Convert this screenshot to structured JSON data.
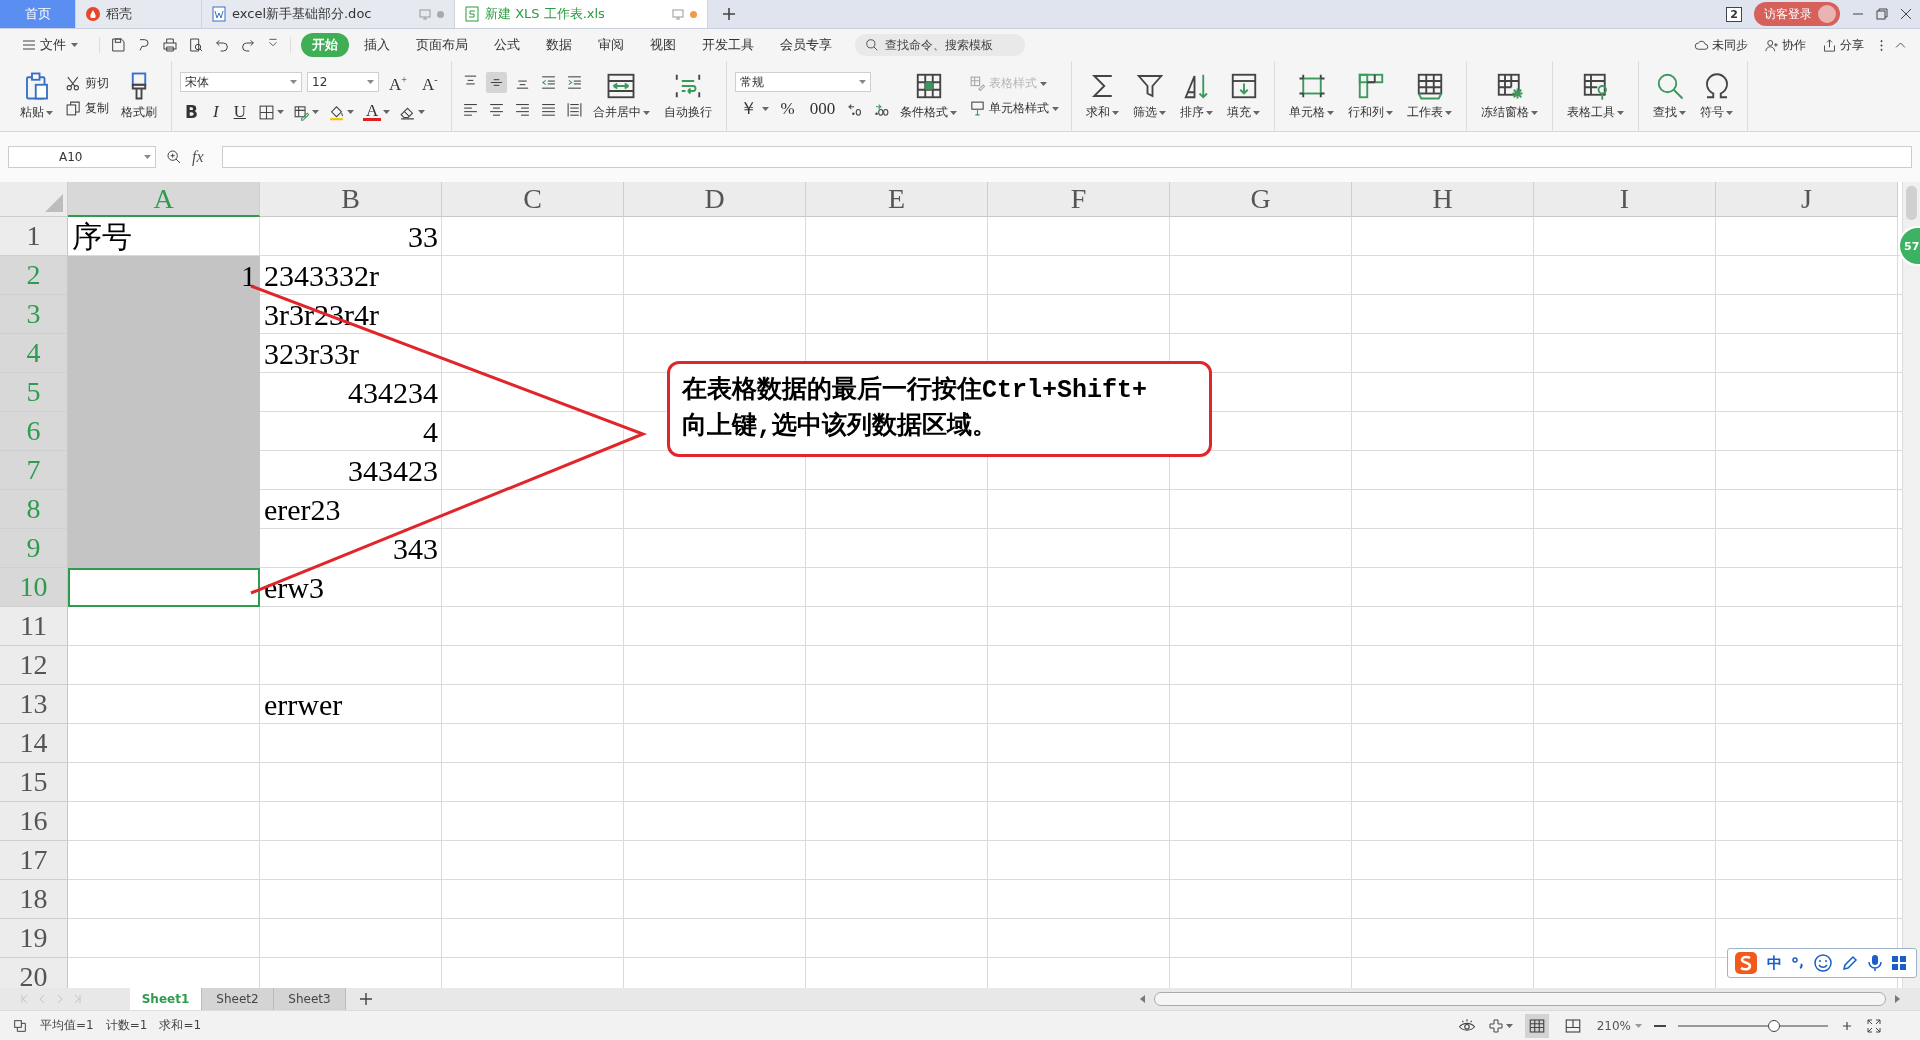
{
  "tabs": [
    {
      "kind": "home",
      "label": "首页",
      "selected": false
    },
    {
      "kind": "docer",
      "label": "稻壳",
      "selected": false
    },
    {
      "kind": "doc",
      "label": "excel新手基础部分.doc",
      "selected": false
    },
    {
      "kind": "xls",
      "label": "新建 XLS 工作表.xls",
      "selected": true
    }
  ],
  "account": {
    "windows": "2",
    "login": "访客登录"
  },
  "menu": {
    "file": "文件",
    "items": [
      {
        "label": "开始",
        "selected": true
      },
      {
        "label": "插入",
        "selected": false
      },
      {
        "label": "页面布局",
        "selected": false
      },
      {
        "label": "公式",
        "selected": false
      },
      {
        "label": "数据",
        "selected": false
      },
      {
        "label": "审阅",
        "selected": false
      },
      {
        "label": "视图",
        "selected": false
      },
      {
        "label": "开发工具",
        "selected": false
      },
      {
        "label": "会员专享",
        "selected": false
      }
    ],
    "search": {
      "placeholder": "查找命令、搜索模板"
    },
    "actions": [
      "未同步",
      "协作",
      "分享"
    ]
  },
  "ribbon": {
    "groups": [
      {
        "items": [
          {
            "kind": "large",
            "label": "粘贴",
            "dropdown": true
          },
          {
            "kind": "stack",
            "items": [
              {
                "kind": "small",
                "label": "剪切",
                "disabled": false,
                "dropdown": false
              },
              {
                "kind": "small",
                "label": "复制",
                "disabled": false,
                "dropdown": false
              }
            ]
          },
          {
            "kind": "large",
            "label": "格式刷",
            "dropdown": false
          }
        ]
      },
      {
        "items": [
          {
            "kind": "rows",
            "rows": [
              [
                {
                  "kind": "font-field",
                  "value": "宋体"
                },
                {
                  "kind": "size-field",
                  "value": "12"
                },
                {
                  "kind": "glyph",
                  "glyph": "A$^{+}$",
                  "dropdown": false
                },
                {
                  "kind": "glyph",
                  "glyph": "A$^{-}$",
                  "dropdown": false
                }
              ],
              [
                {
                  "kind": "bold",
                  "glyph": "B",
                  "dropdown": false
                },
                {
                  "kind": "italic",
                  "glyph": "I",
                  "dropdown": false
                },
                {
                  "kind": "underline",
                  "glyph": "U",
                  "dropdown": false
                },
                {
                  "kind": "icon",
                  "dropdown": true,
                  "selected": false
                },
                {
                  "kind": "icon",
                  "dropdown": true,
                  "selected": false
                },
                {
                  "kind": "icon",
                  "dropdown": true,
                  "selected": false
                },
                {
                  "kind": "font-color",
                  "glyph": "A",
                  "dropdown": true
                },
                {
                  "kind": "icon",
                  "dropdown": true,
                  "selected": false
                }
              ]
            ]
          }
        ]
      },
      {
        "items": [
          {
            "kind": "rows",
            "rows": [
              [
                {
                  "kind": "icon",
                  "dropdown": false,
                  "selected": false
                },
                {
                  "kind": "icon",
                  "dropdown": false,
                  "selected": true
                },
                {
                  "kind": "icon",
                  "dropdown": false,
                  "selected": false
                },
                {
                  "kind": "icon",
                  "dropdown": false,
                  "selected": false
                },
                {
                  "kind": "icon",
                  "dropdown": false,
                  "selected": false
                }
              ],
              [
                {
                  "kind": "icon",
                  "dropdown": false,
                  "selected": false
                },
                {
                  "kind": "icon",
                  "dropdown": false,
                  "selected": false
                },
                {
                  "kind": "icon",
                  "dropdown": false,
                  "selected": false
                },
                {
                  "kind": "icon",
                  "dropdown": false,
                  "selected": false
                },
                {
                  "kind": "icon",
                  "dropdown": false,
                  "selected": false
                }
              ]
            ]
          },
          {
            "kind": "large",
            "label": "合并居中",
            "dropdown": true
          },
          {
            "kind": "large",
            "label": "自动换行",
            "dropdown": false
          }
        ]
      },
      {
        "items": [
          {
            "kind": "rows",
            "rows": [
              [
                {
                  "kind": "format-field",
                  "value": "常规"
                }
              ],
              [
                {
                  "kind": "glyph",
                  "glyph": "￥",
                  "dropdown": true
                },
                {
                  "kind": "glyph",
                  "glyph": "%",
                  "dropdown": false
                },
                {
                  "kind": "glyph",
                  "glyph": "000",
                  "dropdown": false
                },
                {
                  "kind": "icon",
                  "dropdown": false,
                  "selected": false
                },
                {
                  "kind": "icon",
                  "dropdown": false,
                  "selected": false
                }
              ]
            ]
          },
          {
            "kind": "large",
            "label": "条件格式",
            "dropdown": true
          },
          {
            "kind": "stack",
            "items": [
              {
                "kind": "small",
                "label": "表格样式",
                "disabled": true,
                "dropdown": true
              },
              {
                "kind": "small",
                "label": "单元格样式",
                "disabled": false,
                "dropdown": true
              }
            ]
          }
        ]
      },
      {
        "items": [
          {
            "kind": "large",
            "label": "求和",
            "dropdown": true
          },
          {
            "kind": "large",
            "label": "筛选",
            "dropdown": true
          },
          {
            "kind": "large",
            "label": "排序",
            "dropdown": true
          },
          {
            "kind": "large",
            "label": "填充",
            "dropdown": true
          }
        ]
      },
      {
        "items": [
          {
            "kind": "large",
            "label": "单元格",
            "dropdown": true
          },
          {
            "kind": "large",
            "label": "行和列",
            "dropdown": true
          },
          {
            "kind": "large",
            "label": "工作表",
            "dropdown": true
          }
        ]
      },
      {
        "items": [
          {
            "kind": "large",
            "label": "冻结窗格",
            "dropdown": true
          }
        ]
      },
      {
        "items": [
          {
            "kind": "large",
            "label": "表格工具",
            "dropdown": true
          }
        ]
      },
      {
        "items": [
          {
            "kind": "large",
            "label": "查找",
            "dropdown": true
          },
          {
            "kind": "large",
            "label": "符号",
            "dropdown": true
          }
        ]
      }
    ]
  },
  "formula_bar": {
    "name_box": "A10",
    "function_label": "fx"
  },
  "grid": {
    "columns": [
      {
        "label": "A",
        "selected": true
      },
      {
        "label": "B",
        "selected": false
      },
      {
        "label": "C",
        "selected": false
      },
      {
        "label": "D",
        "selected": false
      },
      {
        "label": "E",
        "selected": false
      },
      {
        "label": "F",
        "selected": false
      },
      {
        "label": "G",
        "selected": false
      },
      {
        "label": "H",
        "selected": false
      },
      {
        "label": "I",
        "selected": false
      },
      {
        "label": "J",
        "selected": false
      }
    ],
    "rows": [
      {
        "label": "1",
        "selected": false,
        "cells": {
          "A": {
            "text": "序号",
            "kind": "text",
            "selected": false,
            "active": false
          },
          "B": {
            "text": "33",
            "kind": "number"
          }
        }
      },
      {
        "label": "2",
        "selected": true,
        "cells": {
          "A": {
            "text": "1",
            "kind": "number",
            "selected": true,
            "active": false
          },
          "B": {
            "text": "2343332r",
            "kind": "text"
          }
        }
      },
      {
        "label": "3",
        "selected": true,
        "cells": {
          "A": {
            "selected": true,
            "active": false
          },
          "B": {
            "text": "3r3r23r4r",
            "kind": "text"
          }
        }
      },
      {
        "label": "4",
        "selected": true,
        "cells": {
          "A": {
            "selected": true,
            "active": false
          },
          "B": {
            "text": "323r33r",
            "kind": "text"
          }
        }
      },
      {
        "label": "5",
        "selected": true,
        "cells": {
          "A": {
            "selected": true,
            "active": false
          },
          "B": {
            "text": "434234",
            "kind": "number"
          }
        }
      },
      {
        "label": "6",
        "selected": true,
        "cells": {
          "A": {
            "selected": true,
            "active": false
          },
          "B": {
            "text": "4",
            "kind": "number"
          }
        }
      },
      {
        "label": "7",
        "selected": true,
        "cells": {
          "A": {
            "selected": true,
            "active": false
          },
          "B": {
            "text": "343423",
            "kind": "number"
          }
        }
      },
      {
        "label": "8",
        "selected": true,
        "cells": {
          "A": {
            "selected": true,
            "active": false
          },
          "B": {
            "text": "erer23",
            "kind": "text"
          }
        }
      },
      {
        "label": "9",
        "selected": true,
        "cells": {
          "A": {
            "selected": true,
            "active": false
          },
          "B": {
            "text": "343",
            "kind": "number"
          }
        }
      },
      {
        "label": "10",
        "selected": true,
        "cells": {
          "A": {
            "active": true
          },
          "B": {
            "text": "erw3",
            "kind": "text"
          }
        }
      },
      {
        "label": "11",
        "selected": false,
        "cells": {}
      },
      {
        "label": "12",
        "selected": false,
        "cells": {}
      },
      {
        "label": "13",
        "selected": false,
        "cells": {
          "B": {
            "text": "errwer",
            "kind": "text"
          }
        }
      },
      {
        "label": "14",
        "selected": false,
        "cells": {}
      },
      {
        "label": "15",
        "selected": false,
        "cells": {}
      },
      {
        "label": "16",
        "selected": false,
        "cells": {}
      },
      {
        "label": "17",
        "selected": false,
        "cells": {}
      },
      {
        "label": "18",
        "selected": false,
        "cells": {}
      },
      {
        "label": "19",
        "selected": false,
        "cells": {}
      },
      {
        "label": "20",
        "selected": false,
        "cells": {}
      }
    ]
  },
  "callout": {
    "lines": [
      "在表格数据的最后一行按住Ctrl+Shift+",
      "向上键,选中该列数据区域。"
    ]
  },
  "side_badge": "57",
  "ime": {
    "mode": "中"
  },
  "sheets": [
    {
      "label": "Sheet1",
      "selected": true
    },
    {
      "label": "Sheet2",
      "selected": false
    },
    {
      "label": "Sheet3",
      "selected": false
    }
  ],
  "status_bar": {
    "stats": [
      "平均值=1",
      "计数=1",
      "求和=1"
    ],
    "views": [
      {
        "selected": true
      },
      {
        "selected": false
      }
    ],
    "zoom": "210%",
    "zoom_slider": {
      "level": 0.64
    }
  }
}
